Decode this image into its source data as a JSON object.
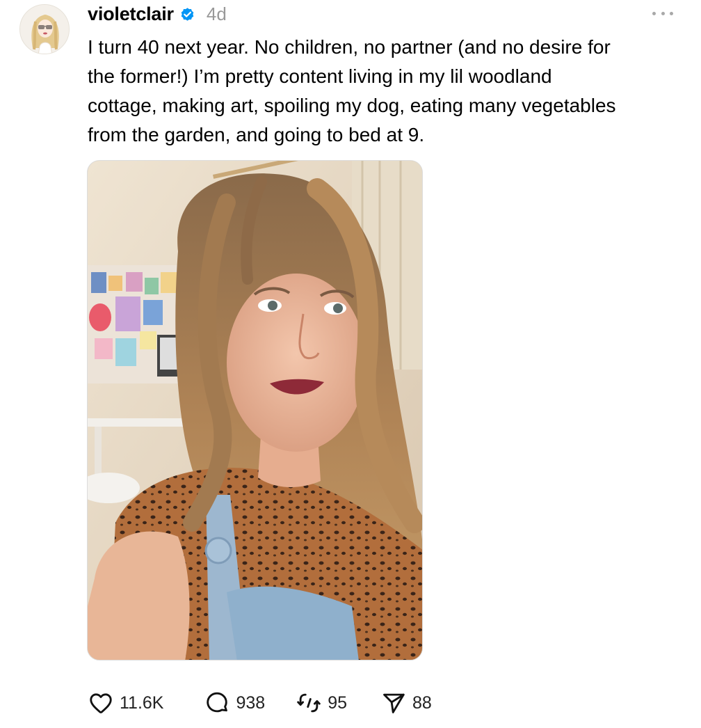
{
  "post": {
    "username": "violetclair",
    "verified": true,
    "timestamp": "4d",
    "text": "I turn 40 next year. No children, no partner (and no desire for\nthe former!) I’m pretty content living in my lil woodland\ncottage, making art, spoiling my dog, eating many vegetables\nfrom the garden, and going to bed at 9.",
    "avatar_icon": "illustrated-avatar-blonde-sunglasses",
    "more_icon": "more-horizontal-icon",
    "verified_color": "#0095f6",
    "image_icon": "selfie-photo"
  },
  "actions": {
    "likes": "11.6K",
    "replies": "938",
    "reposts": "95",
    "shares": "88"
  }
}
